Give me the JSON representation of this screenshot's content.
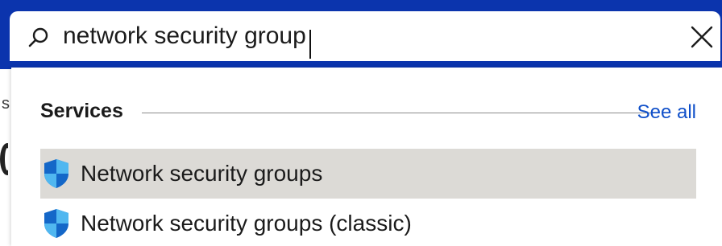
{
  "search": {
    "value": "network security group",
    "icon": "search-icon",
    "clear_icon": "close-icon"
  },
  "dropdown": {
    "section_title": "Services",
    "see_all_label": "See all",
    "results": [
      {
        "label": "Network security groups",
        "icon": "shield-icon",
        "selected": true
      },
      {
        "label": "Network security groups (classic)",
        "icon": "shield-icon",
        "selected": false
      }
    ]
  },
  "colors": {
    "top_bar": "#0b34ad",
    "link": "#0f4fc9",
    "selected_row": "#dcdad6",
    "shield_light": "#50b7f0",
    "shield_dark": "#1467c8"
  }
}
